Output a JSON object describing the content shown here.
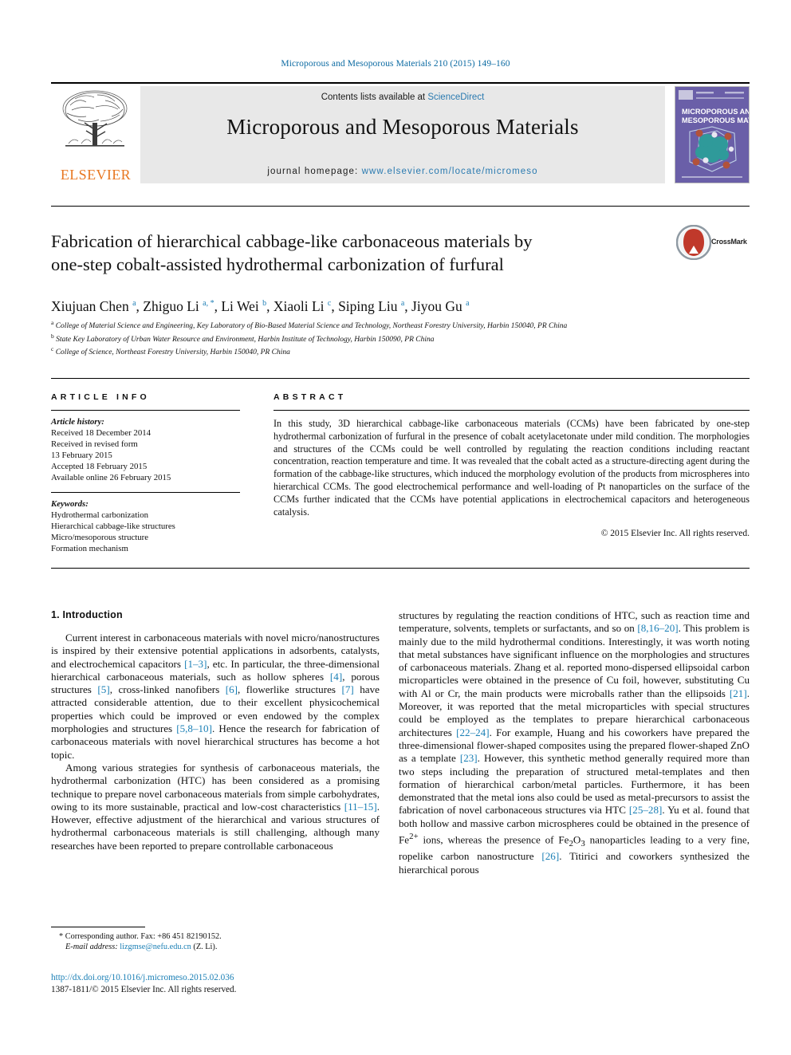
{
  "running_head": "Microporous and Mesoporous Materials 210 (2015) 149–160",
  "masthead": {
    "publisher": "ELSEVIER",
    "contents_prefix": "Contents lists available at ",
    "contents_link": "ScienceDirect",
    "journal_name": "Microporous and Mesoporous Materials",
    "homepage_prefix": "journal homepage: ",
    "homepage_url": "www.elsevier.com/locate/micromeso",
    "cover_title_line1": "MICROPOROUS AND",
    "cover_title_line2": "MESOPOROUS MATERIALS"
  },
  "article": {
    "title_line1": "Fabrication of hierarchical cabbage-like carbonaceous materials by",
    "title_line2": "one-step cobalt-assisted hydrothermal carbonization of furfural",
    "crossmark_label": "CrossMark",
    "authors": [
      {
        "name": "Xiujuan Chen",
        "marks": "a"
      },
      {
        "name": "Zhiguo Li",
        "marks": "a, *"
      },
      {
        "name": "Li Wei",
        "marks": "b"
      },
      {
        "name": "Xiaoli Li",
        "marks": "c"
      },
      {
        "name": "Siping Liu",
        "marks": "a"
      },
      {
        "name": "Jiyou Gu",
        "marks": "a"
      }
    ],
    "affiliations": [
      {
        "mark": "a",
        "text": "College of Material Science and Engineering, Key Laboratory of Bio-Based Material Science and Technology, Northeast Forestry University, Harbin 150040, PR China"
      },
      {
        "mark": "b",
        "text": "State Key Laboratory of Urban Water Resource and Environment, Harbin Institute of Technology, Harbin 150090, PR China"
      },
      {
        "mark": "c",
        "text": "College of Science, Northeast Forestry University, Harbin 150040, PR China"
      }
    ]
  },
  "article_info": {
    "heading": "ARTICLE INFO",
    "history_label": "Article history:",
    "history": [
      "Received 18 December 2014",
      "Received in revised form",
      "13 February 2015",
      "Accepted 18 February 2015",
      "Available online 26 February 2015"
    ],
    "keywords_label": "Keywords:",
    "keywords": [
      "Hydrothermal carbonization",
      "Hierarchical cabbage-like structures",
      "Micro/mesoporous structure",
      "Formation mechanism"
    ]
  },
  "abstract": {
    "heading": "ABSTRACT",
    "text": "In this study, 3D hierarchical cabbage-like carbonaceous materials (CCMs) have been fabricated by one-step hydrothermal carbonization of furfural in the presence of cobalt acetylacetonate under mild condition. The morphologies and structures of the CCMs could be well controlled by regulating the reaction conditions including reactant concentration, reaction temperature and time. It was revealed that the cobalt acted as a structure-directing agent during the formation of the cabbage-like structures, which induced the morphology evolution of the products from microspheres into hierarchical CCMs. The good electrochemical performance and well-loading of Pt nanoparticles on the surface of the CCMs further indicated that the CCMs have potential applications in electrochemical capacitors and heterogeneous catalysis.",
    "rights": "© 2015 Elsevier Inc. All rights reserved."
  },
  "introduction": {
    "heading": "1. Introduction",
    "left_paragraphs": [
      "Current interest in carbonaceous materials with novel micro/nanostructures is inspired by their extensive potential applications in adsorbents, catalysts, and electrochemical capacitors [1–3], etc. In particular, the three-dimensional hierarchical carbonaceous materials, such as hollow spheres [4], porous structures [5], cross-linked nanofibers [6], flowerlike structures [7] have attracted considerable attention, due to their excellent physicochemical properties which could be improved or even endowed by the complex morphologies and structures [5,8–10]. Hence the research for fabrication of carbonaceous materials with novel hierarchical structures has become a hot topic.",
      "Among various strategies for synthesis of carbonaceous materials, the hydrothermal carbonization (HTC) has been considered as a promising technique to prepare novel carbonaceous materials from simple carbohydrates, owing to its more sustainable, practical and low-cost characteristics [11–15]. However, effective adjustment of the hierarchical and various structures of hydrothermal carbonaceous materials is still challenging, although many researches have been reported to prepare controllable carbonaceous"
    ],
    "right_paragraphs": [
      "structures by regulating the reaction conditions of HTC, such as reaction time and temperature, solvents, templets or surfactants, and so on [8,16–20]. This problem is mainly due to the mild hydrothermal conditions. Interestingly, it was worth noting that metal substances have significant influence on the morphologies and structures of carbonaceous materials. Zhang et al. reported mono-dispersed ellipsoidal carbon microparticles were obtained in the presence of Cu foil, however, substituting Cu with Al or Cr, the main products were microballs rather than the ellipsoids [21]. Moreover, it was reported that the metal microparticles with special structures could be employed as the templates to prepare hierarchical carbonaceous architectures [22–24]. For example, Huang and his coworkers have prepared the three-dimensional flower-shaped composites using the prepared flower-shaped ZnO as a template [23]. However, this synthetic method generally required more than two steps including the preparation of structured metal-templates and then formation of hierarchical carbon/metal particles. Furthermore, it has been demonstrated that the metal ions also could be used as metal-precursors to assist the fabrication of novel carbonaceous structures via HTC [25–28]. Yu et al. found that both hollow and massive carbon microspheres could be obtained in the presence of Fe2+ ions, whereas the presence of Fe2O3 nanoparticles leading to a very fine, ropelike carbon nanostructure [26]. Titirici and coworkers synthesized the hierarchical porous"
    ]
  },
  "footnote": {
    "corresponding": "* Corresponding author. Fax: +86 451 82190152.",
    "email_label": "E-mail address:",
    "email": "lizgmse@nefu.edu.cn",
    "email_suffix": "(Z. Li)."
  },
  "footer": {
    "doi": "http://dx.doi.org/10.1016/j.micromeso.2015.02.036",
    "issn_rights": "1387-1811/© 2015 Elsevier Inc. All rights reserved."
  },
  "colors": {
    "link": "#1a7fb5",
    "elsevier_orange": "#E87722",
    "band_gray": "#e8e8e8",
    "cover_purple": "#6a5fa8"
  }
}
